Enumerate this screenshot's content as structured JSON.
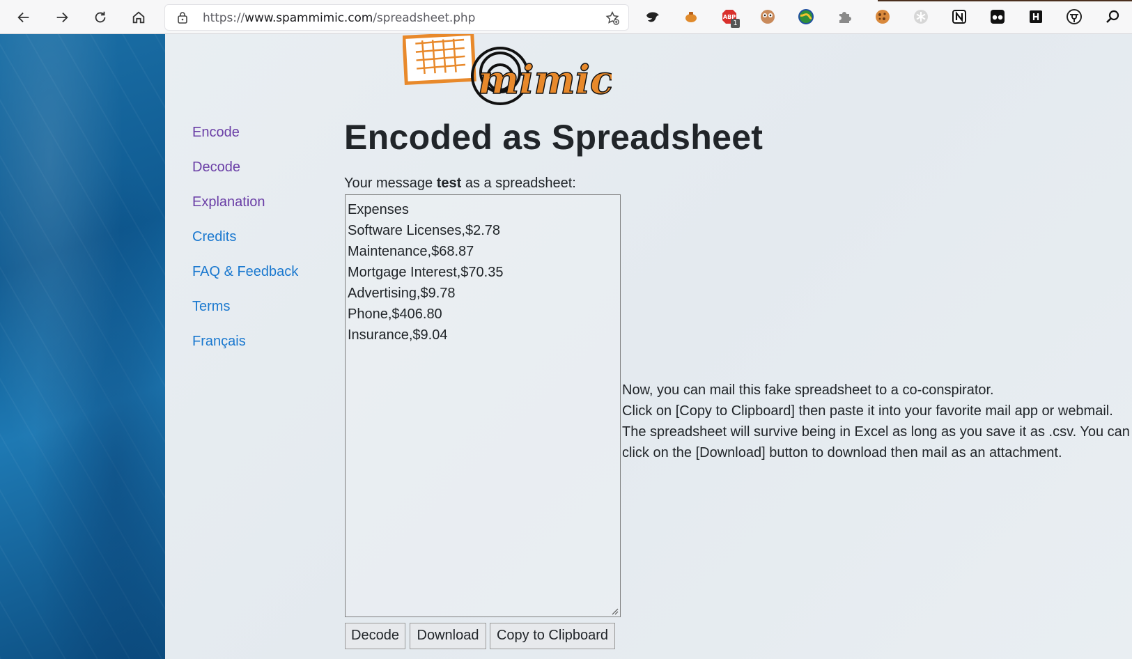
{
  "browser": {
    "url_prefix": "https://",
    "url_host": "www.spammimic.com",
    "url_path": "/spreadsheet.php",
    "extension_badge": "1"
  },
  "logo": {
    "text": "mimic"
  },
  "sidebar": {
    "items": [
      {
        "label": "Encode",
        "state": "visited"
      },
      {
        "label": "Decode",
        "state": "visited"
      },
      {
        "label": "Explanation",
        "state": "visited"
      },
      {
        "label": "Credits",
        "state": "unvisited"
      },
      {
        "label": "FAQ & Feedback",
        "state": "unvisited"
      },
      {
        "label": "Terms",
        "state": "unvisited"
      },
      {
        "label": "Français",
        "state": "unvisited"
      }
    ]
  },
  "main": {
    "title": "Encoded as Spreadsheet",
    "intro_before": "Your message ",
    "intro_message": "test",
    "intro_after": " as a spreadsheet:",
    "spreadsheet_lines": [
      "Expenses",
      "Software Licenses,$2.78",
      "Maintenance,$68.87",
      "Mortgage Interest,$70.35",
      "Advertising,$9.78",
      "Phone,$406.80",
      "Insurance,$9.04"
    ],
    "buttons": {
      "decode": "Decode",
      "download": "Download",
      "copy": "Copy to Clipboard"
    },
    "info_lines": [
      "Now, you can mail this fake spreadsheet to a co-conspirator.",
      "Click on [Copy to Clipboard] then paste it into your favorite mail app or webmail.",
      "The spreadsheet will survive being in Excel as long as you save it as .csv. You can",
      "click on the [Download] button to download then mail as an attachment."
    ]
  },
  "colors": {
    "link_visited": "#6a3ea6",
    "link_unvisited": "#1a78cf",
    "logo_orange": "#e8892b"
  }
}
